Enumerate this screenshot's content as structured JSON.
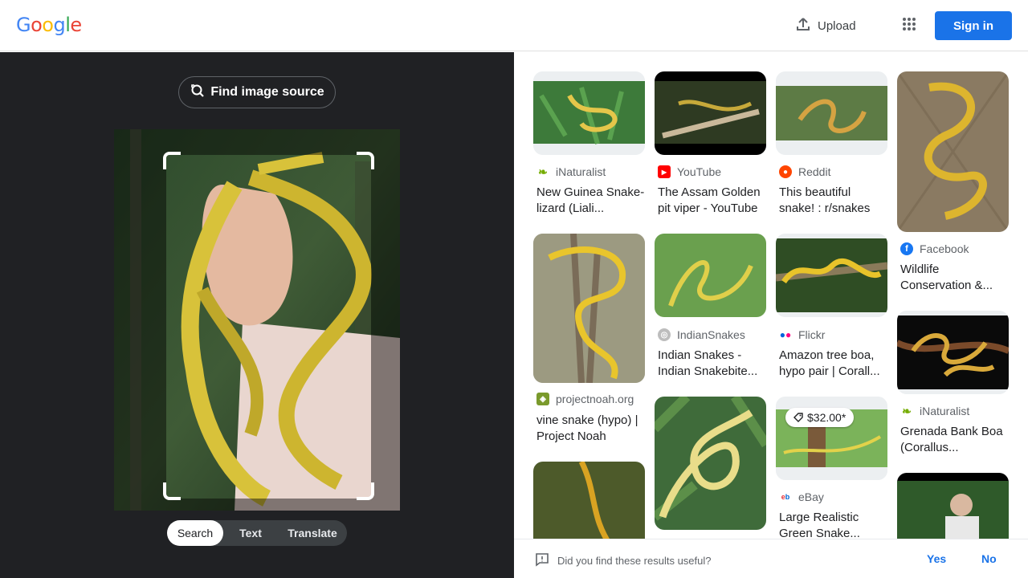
{
  "header": {
    "logo_letters": [
      {
        "ch": "G",
        "color": "#4285F4"
      },
      {
        "ch": "o",
        "color": "#EA4335"
      },
      {
        "ch": "o",
        "color": "#FBBC05"
      },
      {
        "ch": "g",
        "color": "#4285F4"
      },
      {
        "ch": "l",
        "color": "#34A853"
      },
      {
        "ch": "e",
        "color": "#EA4335"
      }
    ],
    "upload_label": "Upload",
    "apps_icon": "apps-grid-icon",
    "signin_label": "Sign in"
  },
  "left": {
    "find_source_label": "Find image source",
    "modes": [
      {
        "label": "Search",
        "active": true
      },
      {
        "label": "Text",
        "active": false
      },
      {
        "label": "Translate",
        "active": false
      }
    ]
  },
  "results": [
    {
      "id": "r1",
      "source": "iNaturalist",
      "favicon": "inaturalist-icon",
      "title": "New Guinea Snake-lizard (Liali..."
    },
    {
      "id": "r2",
      "source": "YouTube",
      "favicon": "youtube-icon",
      "title": "The Assam Golden pit viper - YouTube"
    },
    {
      "id": "r3",
      "source": "Reddit",
      "favicon": "reddit-icon",
      "title": "This beautiful snake! : r/snakes"
    },
    {
      "id": "r4",
      "source": "Facebook",
      "favicon": "facebook-icon",
      "title": "Wildlife Conservation &..."
    },
    {
      "id": "r5",
      "source": "projectnoah.org",
      "favicon": "projectnoah-icon",
      "title": "vine snake (hypo) | Project Noah"
    },
    {
      "id": "r6",
      "source": "IndianSnakes",
      "favicon": "indiansnakes-icon",
      "title": "Indian Snakes - Indian Snakebite..."
    },
    {
      "id": "r7",
      "source": "Flickr",
      "favicon": "flickr-icon",
      "title": "Amazon tree boa, hypo pair | Corall..."
    },
    {
      "id": "r8",
      "source": "iNaturalist",
      "favicon": "inaturalist-icon",
      "title": "Grenada Bank Boa (Corallus..."
    },
    {
      "id": "r9",
      "source": "eBay",
      "favicon": "ebay-icon",
      "title": "Large Realistic Green Snake...",
      "price": "$32.00*"
    }
  ],
  "feedback": {
    "question": "Did you find these results useful?",
    "yes_label": "Yes",
    "no_label": "No"
  }
}
